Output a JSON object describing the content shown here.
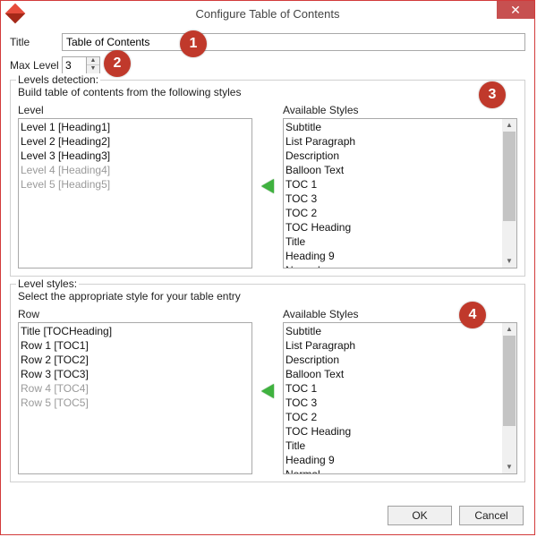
{
  "window": {
    "title": "Configure Table of Contents"
  },
  "fields": {
    "titleLabel": "Title",
    "titleValue": "Table of Contents",
    "maxLevelLabel": "Max Level",
    "maxLevelValue": "3"
  },
  "levelsDetection": {
    "legend": "Levels detection:",
    "description": "Build table of contents from the following styles",
    "levelHeader": "Level",
    "availHeader": "Available Styles",
    "levels": [
      {
        "text": "Level 1 [Heading1]",
        "enabled": true
      },
      {
        "text": "Level 2 [Heading2]",
        "enabled": true
      },
      {
        "text": "Level 3 [Heading3]",
        "enabled": true
      },
      {
        "text": "Level 4 [Heading4]",
        "enabled": false
      },
      {
        "text": "Level 5 [Heading5]",
        "enabled": false
      }
    ],
    "available": [
      "Subtitle",
      "List Paragraph",
      "Description",
      "Balloon Text",
      "TOC 1",
      "TOC 3",
      "TOC 2",
      "TOC Heading",
      "Title",
      "Heading 9",
      "Normal"
    ]
  },
  "levelStyles": {
    "legend": "Level styles:",
    "description": "Select the appropriate style for your table entry",
    "rowHeader": "Row",
    "availHeader": "Available Styles",
    "rows": [
      {
        "text": "Title [TOCHeading]",
        "enabled": true
      },
      {
        "text": "Row 1 [TOC1]",
        "enabled": true
      },
      {
        "text": "Row 2 [TOC2]",
        "enabled": true
      },
      {
        "text": "Row 3 [TOC3]",
        "enabled": true
      },
      {
        "text": "Row 4 [TOC4]",
        "enabled": false
      },
      {
        "text": "Row 5 [TOC5]",
        "enabled": false
      }
    ],
    "available": [
      "Subtitle",
      "List Paragraph",
      "Description",
      "Balloon Text",
      "TOC 1",
      "TOC 3",
      "TOC 2",
      "TOC Heading",
      "Title",
      "Heading 9",
      "Normal"
    ]
  },
  "buttons": {
    "ok": "OK",
    "cancel": "Cancel"
  },
  "callouts": {
    "c1": "1",
    "c2": "2",
    "c3": "3",
    "c4": "4"
  }
}
